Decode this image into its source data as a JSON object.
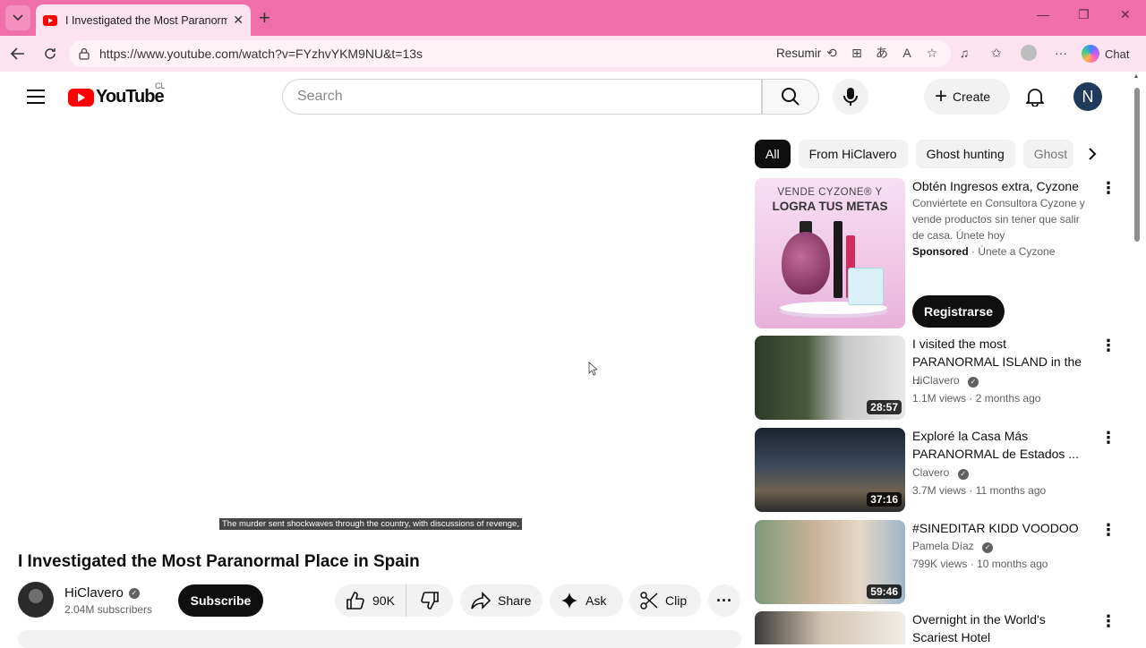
{
  "browser": {
    "tab_title": "I Investigated the Most Paranormal Place in Spain - YouTube",
    "url": "https://www.youtube.com/watch?v=FYzhvYKM9NU&t=13s",
    "resumir_label": "Resumir",
    "chat_label": "Chat",
    "accent_color": "#f06fa9"
  },
  "header": {
    "logo_text": "YouTube",
    "country_code": "CL",
    "search_placeholder": "Search",
    "create_label": "Create",
    "avatar_letter": "N"
  },
  "video": {
    "caption": "The murder sent shockwaves through the country, with discussions of revenge,",
    "title": "I Investigated the Most Paranormal Place in Spain",
    "channel_name": "HiClavero",
    "subscribers": "2.04M subscribers",
    "subscribe_label": "Subscribe",
    "likes": "90K",
    "share_label": "Share",
    "ask_label": "Ask",
    "clip_label": "Clip"
  },
  "chips": [
    "All",
    "From HiClavero",
    "Ghost hunting",
    "Ghost"
  ],
  "ad": {
    "thumb_line1": "VENDE CYZONE® Y",
    "thumb_line2": "LOGRA TUS METAS",
    "title": "Obtén Ingresos extra, Cyzone",
    "description": "Conviértete en Consultora Cyzone y vende productos sin tener que salir de casa. Únete hoy",
    "sponsored": "Sponsored",
    "advertiser": "Únete a Cyzone",
    "cta": "Registrarse"
  },
  "recommendations": [
    {
      "title": "I visited the most PARANORMAL ISLAND in the ...",
      "channel": "HiClavero",
      "views": "1.1M views",
      "age": "2 months ago",
      "duration": "28:57"
    },
    {
      "title": "Exploré la Casa Más PARANORMAL de Estados ...",
      "channel": "Clavero",
      "views": "3.7M views",
      "age": "11 months ago",
      "duration": "37:16"
    },
    {
      "title": "#SINEDITAR KIDD VOODOO",
      "channel": "Pamela Díaz",
      "views": "799K views",
      "age": "10 months ago",
      "duration": "59:46"
    },
    {
      "title": "Overnight in the World's Scariest Hotel",
      "channel": "",
      "views": "",
      "age": "",
      "duration": ""
    }
  ]
}
